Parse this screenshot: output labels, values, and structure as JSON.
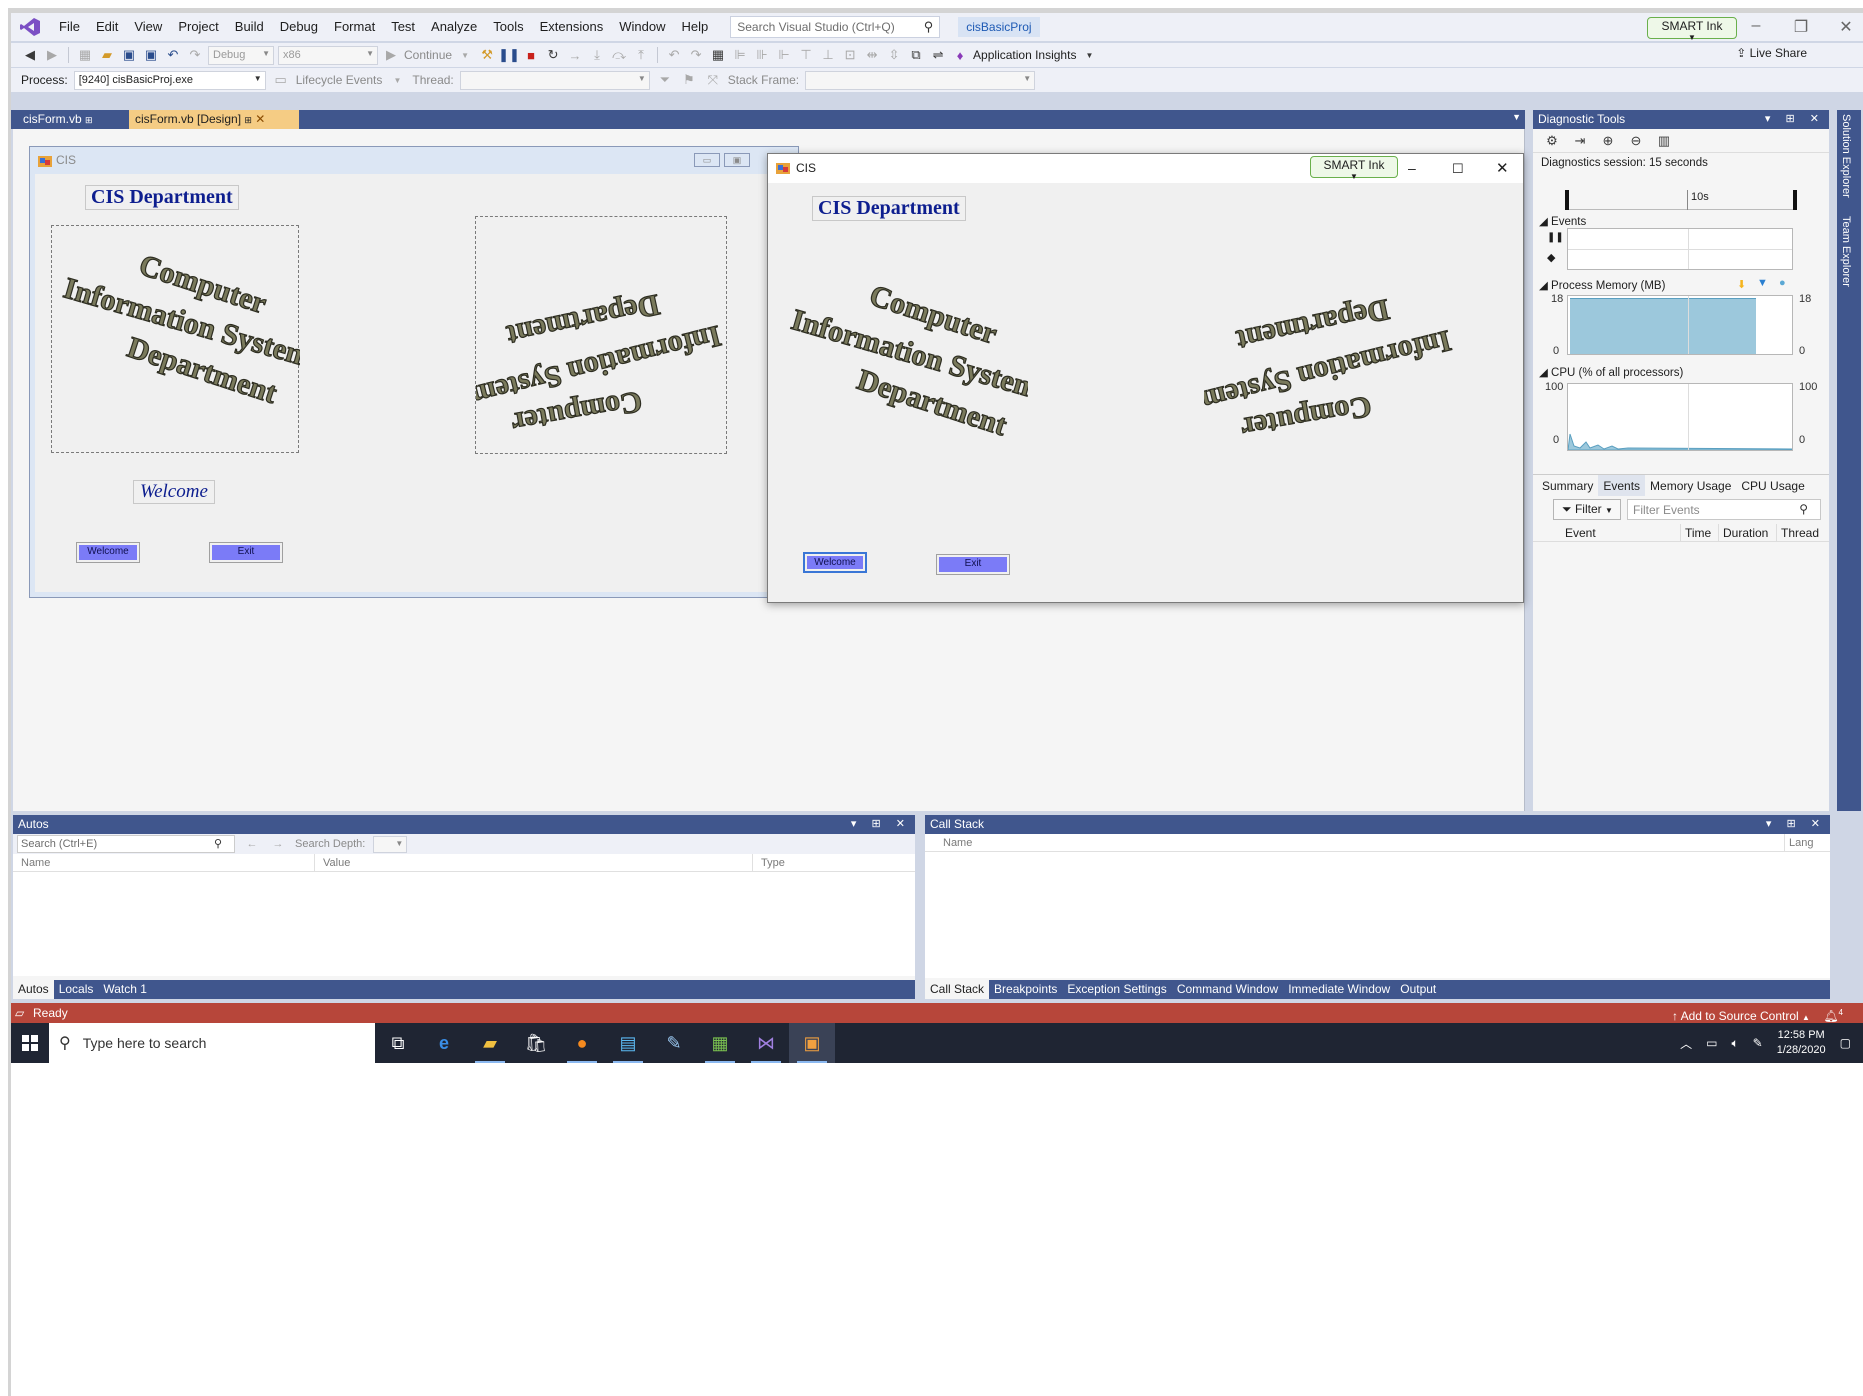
{
  "menu": {
    "items": [
      "File",
      "Edit",
      "View",
      "Project",
      "Build",
      "Debug",
      "Format",
      "Test",
      "Analyze",
      "Tools",
      "Extensions",
      "Window",
      "Help"
    ],
    "search_placeholder": "Search Visual Studio (Ctrl+Q)",
    "solution_name": "cisBasicProj",
    "smart_ink": "SMART Ink"
  },
  "toolbar": {
    "config": "Debug",
    "platform": "x86",
    "continue_label": "Continue",
    "app_insights": "Application Insights",
    "live_share": "Live Share",
    "process_label": "Process:",
    "process_value": "[9240] cisBasicProj.exe",
    "lifecycle": "Lifecycle Events",
    "thread_label": "Thread:",
    "stack_frame_label": "Stack Frame:"
  },
  "doc_tabs": {
    "code_tab": "cisForm.vb",
    "design_tab": "cisForm.vb [Design]"
  },
  "design_form": {
    "caption": "CIS",
    "title": "CIS Department",
    "welcome_label": "Welcome",
    "welcome_button": "Welcome",
    "exit_button": "Exit",
    "art_words": [
      "Computer",
      "Information Systems",
      "Department"
    ]
  },
  "run_form": {
    "caption": "CIS",
    "smart_ink": "SMART Ink",
    "title": "CIS Department",
    "welcome_button": "Welcome",
    "exit_button": "Exit"
  },
  "diagnostics": {
    "title": "Diagnostic Tools",
    "session": "Diagnostics session: 15 seconds",
    "timeline_mark": "10s",
    "events_label": "Events",
    "memory_label": "Process Memory (MB)",
    "memory_max": "18",
    "memory_min": "0",
    "cpu_label": "CPU (% of all processors)",
    "cpu_max": "100",
    "cpu_min": "0",
    "tabs": [
      "Summary",
      "Events",
      "Memory Usage",
      "CPU Usage"
    ],
    "active_tab": "Events",
    "filter_label": "Filter",
    "filter_placeholder": "Filter Events",
    "columns": [
      "Event",
      "Time",
      "Duration",
      "Thread"
    ]
  },
  "right_rail": {
    "tabs": [
      "Solution Explorer",
      "Team Explorer"
    ]
  },
  "autos": {
    "title": "Autos",
    "search_placeholder": "Search (Ctrl+E)",
    "search_depth": "Search Depth:",
    "columns": [
      "Name",
      "Value",
      "Type"
    ],
    "tabs": [
      "Autos",
      "Locals",
      "Watch 1"
    ]
  },
  "callstack": {
    "title": "Call Stack",
    "columns": [
      "Name",
      "Lang"
    ],
    "tabs": [
      "Call Stack",
      "Breakpoints",
      "Exception Settings",
      "Command Window",
      "Immediate Window",
      "Output"
    ]
  },
  "status": {
    "text": "Ready",
    "source_control": "Add to Source Control",
    "notifications": "4"
  },
  "taskbar": {
    "search_placeholder": "Type here to search",
    "time": "12:58 PM",
    "date": "1/28/2020"
  },
  "colors": {
    "accent": "#40568d",
    "status_bar": "#b7463a",
    "active_tab": "#f5cc84",
    "button_fill": "#7b7bf7",
    "title_text": "#0d1e8f",
    "memory_fill": "#9cc8dc"
  }
}
